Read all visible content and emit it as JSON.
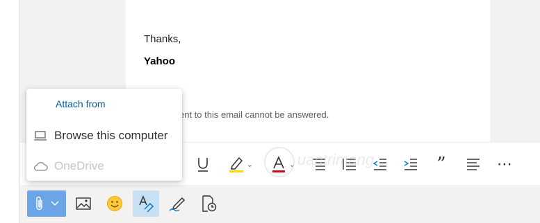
{
  "email": {
    "closing": "Thanks,",
    "sender": "Yahoo",
    "note": "ent to this email cannot be answered."
  },
  "attach_menu": {
    "title": "Attach from",
    "items": [
      {
        "label": "Browse this computer",
        "icon": "laptop-icon",
        "enabled": true
      },
      {
        "label": "OneDrive",
        "icon": "cloud-icon",
        "enabled": false
      }
    ]
  },
  "format_toolbar": {
    "quote_glyph": "”",
    "more_glyph": "⋯",
    "items": [
      "underline",
      "highlight",
      "font-color",
      "bullets",
      "numbering",
      "decrease-indent",
      "increase-indent",
      "quote",
      "align",
      "more"
    ]
  },
  "bottom_toolbar": {
    "items": [
      "attach",
      "insert-picture",
      "emoji",
      "format-text",
      "signature",
      "schedule-send"
    ]
  },
  "watermark": {
    "text": "uantrimang"
  },
  "colors": {
    "accent": "#0078d4",
    "highlight": "#ffd800",
    "font_color": "#c50f1f",
    "attach_active": "#6ba5e7"
  }
}
